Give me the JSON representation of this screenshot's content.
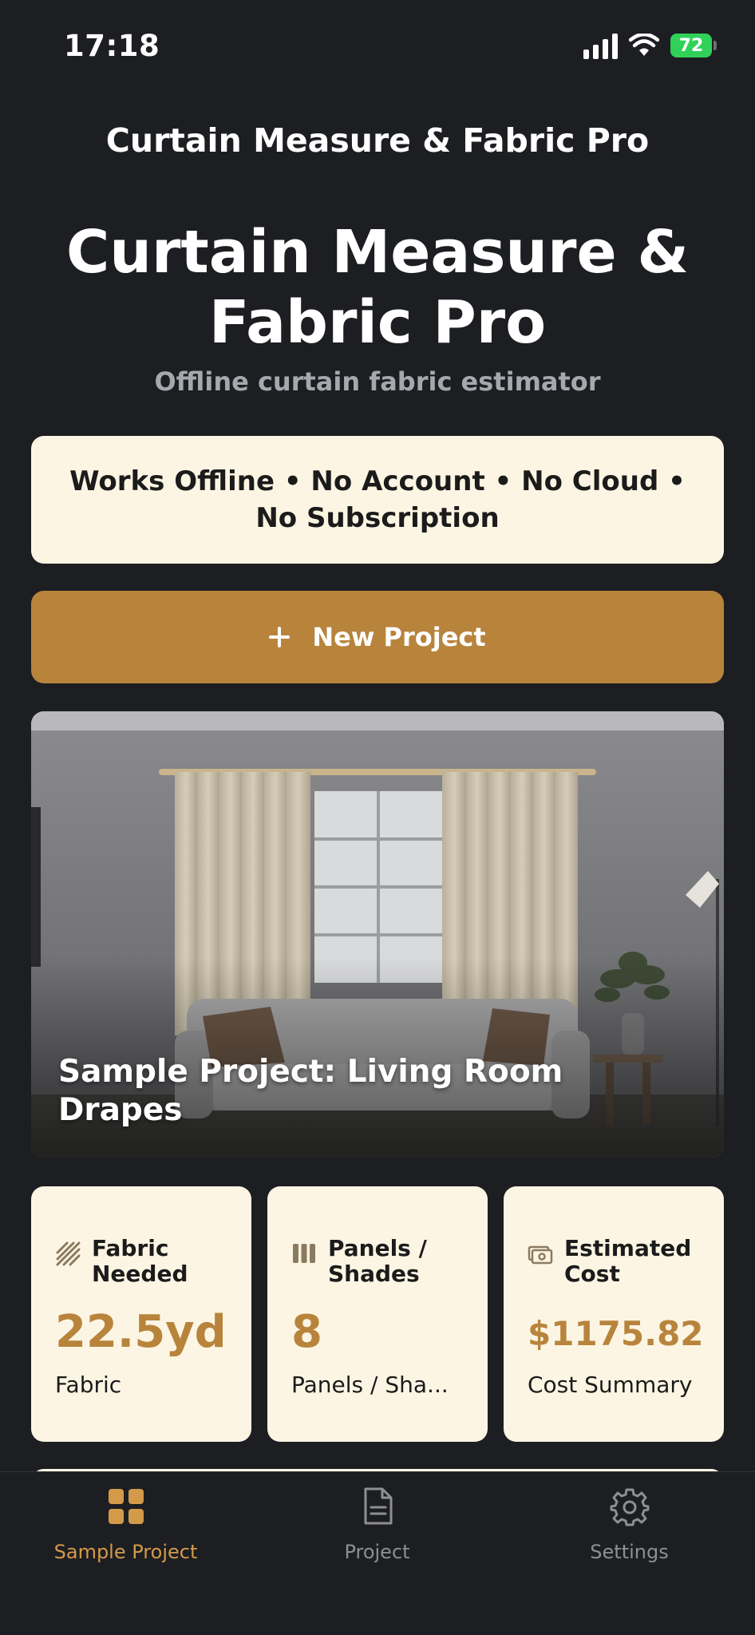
{
  "status_bar": {
    "time": "17:18",
    "battery": "72",
    "battery_color": "#30d158"
  },
  "nav": {
    "title": "Curtain Measure & Fabric Pro"
  },
  "hero": {
    "title": "Curtain Measure & Fabric Pro",
    "subtitle": "Offline curtain fabric estimator"
  },
  "offline_banner": {
    "text": "Works Offline • No Account • No Cloud • No Subscription"
  },
  "new_project_button": {
    "label": "New Project",
    "icon": "plus-icon"
  },
  "sample_project": {
    "title": "Sample Project: Living Room Drapes"
  },
  "stats": [
    {
      "label": "Fabric Needed",
      "value": "22.5yd",
      "caption": "Fabric",
      "icon": "fabric-swatch-icon"
    },
    {
      "label": "Panels / Shades",
      "value": "8",
      "caption": "Panels / Sha...",
      "icon": "panels-icon"
    },
    {
      "label": "Estimated Cost",
      "value": "$1175.82",
      "caption": "Cost Summary",
      "icon": "money-icon"
    }
  ],
  "tab_bar": {
    "tabs": [
      {
        "label": "Sample Project",
        "icon": "grid-icon",
        "active": true
      },
      {
        "label": "Project",
        "icon": "document-icon",
        "active": false
      },
      {
        "label": "Settings",
        "icon": "gear-icon",
        "active": false
      }
    ]
  },
  "colors": {
    "background": "#1d1e22",
    "card": "#fcf5e3",
    "accent": "#b8843c",
    "active_tab": "#d39a4a"
  }
}
